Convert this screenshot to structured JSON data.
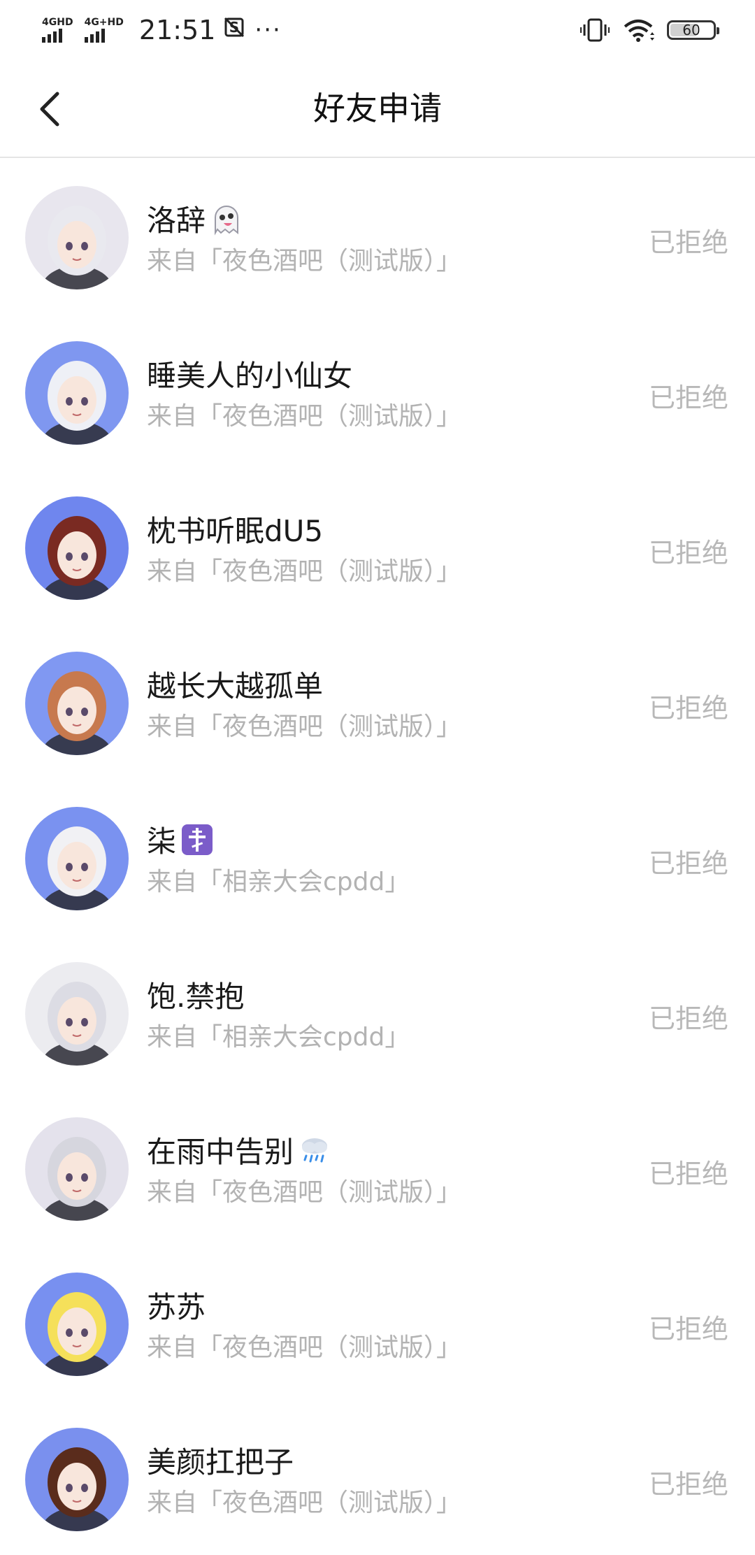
{
  "status_bar": {
    "signal1_label": "4GHD",
    "signal2_label": "4G+HD",
    "time": "21:51",
    "notification_icon": "S",
    "more_dots": "···",
    "battery_level": "60"
  },
  "nav": {
    "title": "好友申请"
  },
  "requests": [
    {
      "name": "洛辞",
      "emoji": "ghost",
      "source": "来自「夜色酒吧（测试版）」",
      "status": "已拒绝",
      "avatar_bg": "#e8e6ee",
      "hair": "#e9e9ef"
    },
    {
      "name": "睡美人的小仙女",
      "emoji": "",
      "source": "来自「夜色酒吧（测试版）」",
      "status": "已拒绝",
      "avatar_bg": "#7f97f0",
      "hair": "#eef0f6"
    },
    {
      "name": "枕书听眠dU5",
      "emoji": "",
      "source": "来自「夜色酒吧（测试版）」",
      "status": "已拒绝",
      "avatar_bg": "#6f86ee",
      "hair": "#7a2a22"
    },
    {
      "name": "越长大越孤单",
      "emoji": "",
      "source": "来自「夜色酒吧（测试版）」",
      "status": "已拒绝",
      "avatar_bg": "#8098f2",
      "hair": "#c7794e"
    },
    {
      "name": "柒",
      "emoji": "orthodox-cross",
      "source": "来自「相亲大会cpdd」",
      "status": "已拒绝",
      "avatar_bg": "#7a92f0",
      "hair": "#f1f1f4"
    },
    {
      "name": "饱.禁抱",
      "emoji": "",
      "source": "来自「相亲大会cpdd」",
      "status": "已拒绝",
      "avatar_bg": "#ececf0",
      "hair": "#dcdce4"
    },
    {
      "name": "在雨中告别",
      "emoji": "rain-cloud",
      "source": "来自「夜色酒吧（测试版）」",
      "status": "已拒绝",
      "avatar_bg": "#e4e2ec",
      "hair": "#d6d6de"
    },
    {
      "name": "苏苏",
      "emoji": "",
      "source": "来自「夜色酒吧（测试版）」",
      "status": "已拒绝",
      "avatar_bg": "#7890f0",
      "hair": "#f5e05a"
    },
    {
      "name": "美颜扛把子",
      "emoji": "",
      "source": "来自「夜色酒吧（测试版）」",
      "status": "已拒绝",
      "avatar_bg": "#7a90ee",
      "hair": "#5a2c1c"
    }
  ],
  "colors": {
    "accent_emoji_purple": "#7b5cc9",
    "status_text": "#b8b8b8",
    "source_text": "#b3b3b3"
  }
}
